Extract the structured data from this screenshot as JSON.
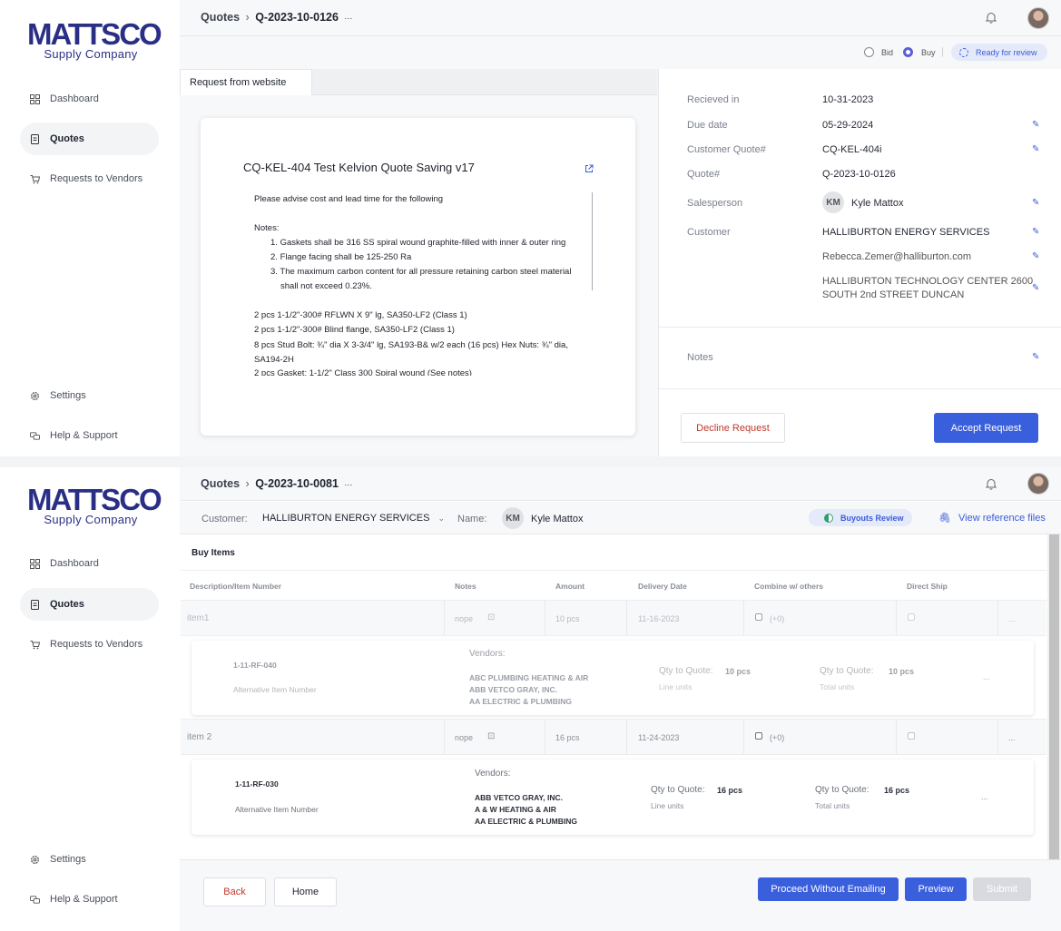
{
  "brand": {
    "logo_word": "MATTSCO",
    "logo_sub": "Supply Company"
  },
  "nav": {
    "dashboard": "Dashboard",
    "quotes": "Quotes",
    "requests_to_vendors": "Requests to Vendors",
    "settings": "Settings",
    "help": "Help & Support"
  },
  "screen1": {
    "breadcrumb": {
      "root": "Quotes",
      "separator": "›",
      "current": "Q-2023-10-0126",
      "more": "···"
    },
    "mode": {
      "bid_label": "Bid",
      "buy_label": "Buy",
      "selected": "Buy",
      "divider": "|",
      "status_label": "Ready for review"
    },
    "tab_label": "Request from website",
    "request": {
      "title": "CQ-KEL-404 Test Kelvion Quote Saving v17",
      "intro": "Please advise cost and lead time for the following",
      "notes_heading": "Notes:",
      "notes": [
        {
          "num": "1.",
          "text": "Gaskets shall be 316 SS spiral wound graphite-filled with inner & outer ring"
        },
        {
          "num": "2.",
          "text": "Flange facing shall be 125-250 Ra"
        },
        {
          "num": "3.",
          "text": "The maximum carbon content for all pressure retaining carbon steel material"
        },
        {
          "num": "",
          "text": "shall not exceed 0.23%."
        }
      ],
      "lines": [
        "2 pcs  1-1/2\"-300# RFLWN X 9\" lg, SA350-LF2 (Class 1)",
        "2 pcs  1-1/2\"-300# Blind flange, SA350-LF2 (Class 1)",
        "8 pcs  Stud Bolt:  ¾\" dia X 3-3/4\" lg, SA193-B& w/2 each (16 pcs) Hex Nuts: ¾\" dia,",
        "SA194-2H",
        "2 pcs  Gasket: 1-1/2\" Class 300  Spiral wound  (See notes)"
      ]
    },
    "details": {
      "received_label": "Recieved in",
      "received_value": "10-31-2023",
      "due_label": "Due date",
      "due_value": "05-29-2024",
      "customer_quote_label": "Customer Quote#",
      "customer_quote_value": "CQ-KEL-404i",
      "quote_label": "Quote#",
      "quote_value": "Q-2023-10-0126",
      "salesperson_label": "Salesperson",
      "salesperson_initials": "KM",
      "salesperson_name": "Kyle Mattox",
      "customer_label": "Customer",
      "customer_name": "HALLIBURTON ENERGY SERVICES",
      "customer_email": "Rebecca.Zemer@halliburton.com",
      "address_line1": "HALLIBURTON TECHNOLOGY CENTER  2600",
      "address_line2": "SOUTH 2nd STREET    DUNCAN",
      "notes_label": "Notes"
    },
    "actions": {
      "decline": "Decline Request",
      "accept": "Accept Request"
    }
  },
  "screen2": {
    "breadcrumb": {
      "root": "Quotes",
      "separator": "›",
      "current": "Q-2023-10-0081",
      "more": "···"
    },
    "customer_label": "Customer:",
    "customer_value": "HALLIBURTON ENERGY SERVICES",
    "name_label": "Name:",
    "name_initials": "KM",
    "name_value": "Kyle Mattox",
    "status_label": "Buyouts Review",
    "reference_link": "View reference files",
    "section_title": "Buy Items",
    "columns": [
      "Description/Item Number",
      "Notes",
      "Amount",
      "Delivery Date",
      "Combine w/ others",
      "Direct Ship"
    ],
    "items": [
      {
        "description": "item1",
        "notes": "nope",
        "amount": "10 pcs",
        "delivery": "11-16-2023",
        "combine": "(+0)",
        "more": "...",
        "detail": {
          "item_number": "1-11-RF-040",
          "alt_label": "Alternative Item Number",
          "vendors_label": "Vendors:",
          "vendors": [
            "ABC PLUMBING HEATING & AIR",
            "ABB VETCO GRAY, INC.",
            "AA ELECTRIC & PLUMBING"
          ],
          "qty_label": "Qty to Quote:",
          "line_qty": "10 pcs",
          "line_units_label": "Line units",
          "total_qty": "10 pcs",
          "total_units_label": "Total units",
          "more": "..."
        }
      },
      {
        "description": "item 2",
        "notes": "nope",
        "amount": "16 pcs",
        "delivery": "11-24-2023",
        "combine": "(+0)",
        "more": "...",
        "detail": {
          "item_number": "1-11-RF-030",
          "alt_label": "Alternative Item Number",
          "vendors_label": "Vendors:",
          "vendors": [
            "ABB VETCO GRAY, INC.",
            "A & W HEATING & AIR",
            "AA ELECTRIC & PLUMBING"
          ],
          "qty_label": "Qty to Quote:",
          "line_qty": "16 pcs",
          "line_units_label": "Line units",
          "total_qty": "16 pcs",
          "total_units_label": "Total units",
          "more": "..."
        }
      }
    ],
    "actions": {
      "back": "Back",
      "home": "Home",
      "proceed": "Proceed Without Emailing",
      "preview": "Preview",
      "submit": "Submit"
    }
  },
  "colors": {
    "primary": "#3a5fdc",
    "brand": "#2a2f86",
    "decline": "#c0392b",
    "pill_bg": "#e4eaf9"
  }
}
